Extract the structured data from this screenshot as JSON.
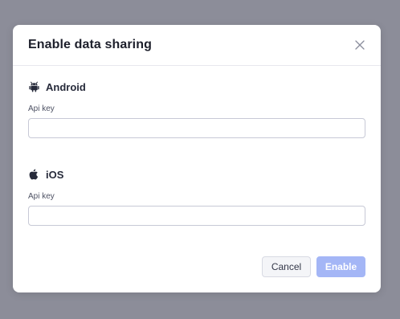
{
  "modal": {
    "title": "Enable data sharing",
    "close_icon": "close-icon"
  },
  "android": {
    "icon": "android-icon",
    "label": "Android",
    "api_key_label": "Api key",
    "api_key_value": "",
    "api_key_placeholder": ""
  },
  "ios": {
    "icon": "apple-icon",
    "label": "iOS",
    "api_key_label": "Api key",
    "api_key_value": "",
    "api_key_placeholder": ""
  },
  "footer": {
    "cancel_label": "Cancel",
    "enable_label": "Enable"
  },
  "colors": {
    "overlay": "#8c8d99",
    "primary_disabled": "#a4b6f6"
  }
}
